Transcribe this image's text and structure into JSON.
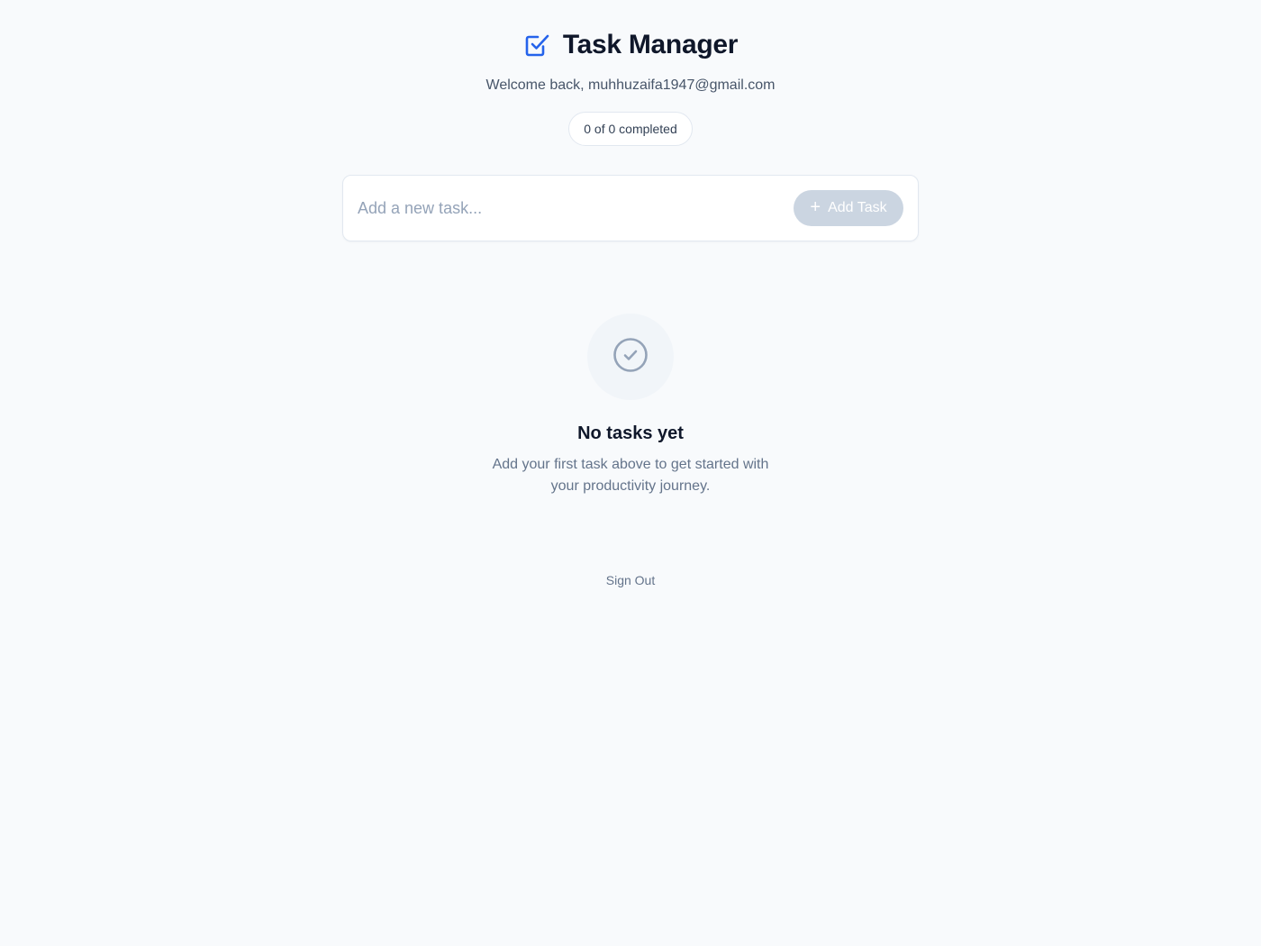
{
  "app": {
    "title": "Task Manager",
    "accent_color": "#2563eb",
    "logo_icon": "checkbox-checked-icon"
  },
  "header": {
    "welcome_text": "Welcome back, muhhuzaifa1947@gmail.com"
  },
  "progress": {
    "label": "0 of 0 completed",
    "completed": 0,
    "total": 0
  },
  "task_input": {
    "placeholder": "Add a new task...",
    "value": "",
    "button_label": "Add Task",
    "button_icon": "plus-icon",
    "button_enabled": false
  },
  "empty_state": {
    "icon": "check-circle-icon",
    "title": "No tasks yet",
    "description": "Add your first task above to get started with your productivity journey."
  },
  "footer": {
    "signout_label": "Sign Out"
  }
}
